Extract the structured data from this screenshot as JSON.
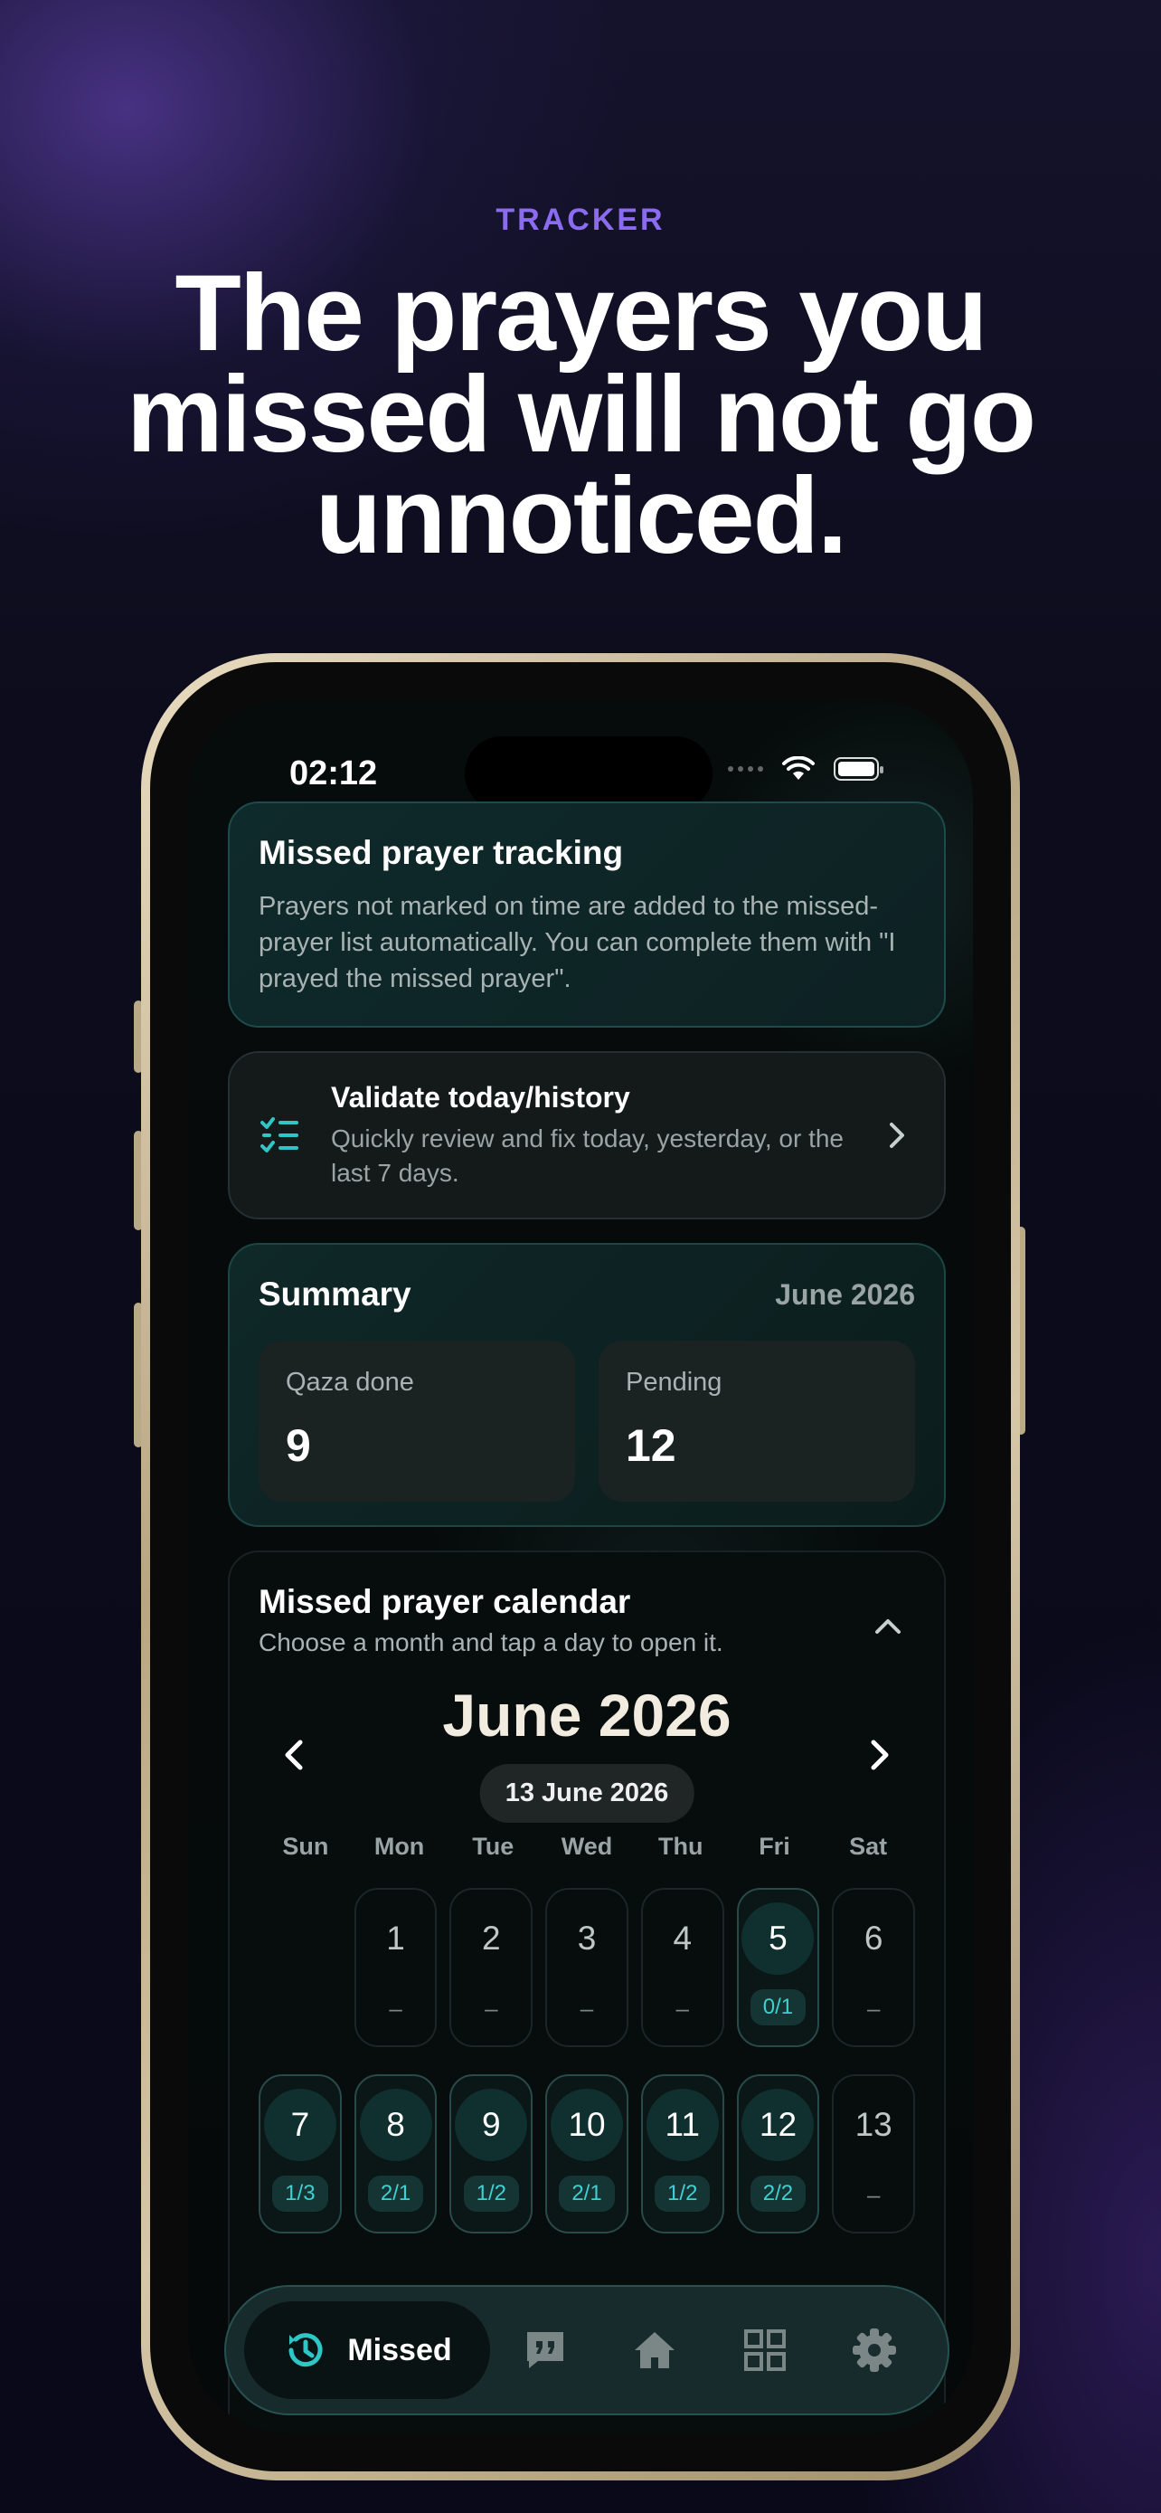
{
  "marketing": {
    "eyebrow": "TRACKER",
    "headline": "The prayers you missed will not go unnoticed."
  },
  "status_bar": {
    "time": "02:12"
  },
  "missed_card": {
    "title": "Missed prayer tracking",
    "body": "Prayers not marked on time are added to the missed-prayer list automatically. You can complete them with \"I prayed the missed prayer\"."
  },
  "validate_card": {
    "title": "Validate today/history",
    "subtitle": "Quickly review and fix today, yesterday, or the last 7 days."
  },
  "summary": {
    "title": "Summary",
    "month": "June 2026",
    "stats": [
      {
        "label": "Qaza done",
        "value": "9"
      },
      {
        "label": "Pending",
        "value": "12"
      }
    ]
  },
  "calendar": {
    "title": "Missed prayer calendar",
    "subtitle": "Choose a month and tap a day to open it.",
    "month_label": "June 2026",
    "selected_date": "13 June 2026",
    "weekdays": [
      "Sun",
      "Mon",
      "Tue",
      "Wed",
      "Thu",
      "Fri",
      "Sat"
    ],
    "weeks": [
      [
        {
          "day": "",
          "sub": ""
        },
        {
          "day": "1",
          "sub": "–"
        },
        {
          "day": "2",
          "sub": "–"
        },
        {
          "day": "3",
          "sub": "–"
        },
        {
          "day": "4",
          "sub": "–"
        },
        {
          "day": "5",
          "sub": "0/1"
        },
        {
          "day": "6",
          "sub": "–"
        }
      ],
      [
        {
          "day": "7",
          "sub": "1/3"
        },
        {
          "day": "8",
          "sub": "2/1"
        },
        {
          "day": "9",
          "sub": "1/2"
        },
        {
          "day": "10",
          "sub": "2/1"
        },
        {
          "day": "11",
          "sub": "1/2"
        },
        {
          "day": "12",
          "sub": "2/2"
        },
        {
          "day": "13",
          "sub": "–"
        }
      ]
    ]
  },
  "tabbar": {
    "active_label": "Missed",
    "tabs": [
      "history-icon",
      "quote-icon",
      "home-icon",
      "grid-icon",
      "settings-icon"
    ]
  },
  "colors": {
    "accent_teal": "#3fd0d0",
    "accent_purple": "#8b6cf0",
    "card_teal": "#0f2a2b"
  }
}
